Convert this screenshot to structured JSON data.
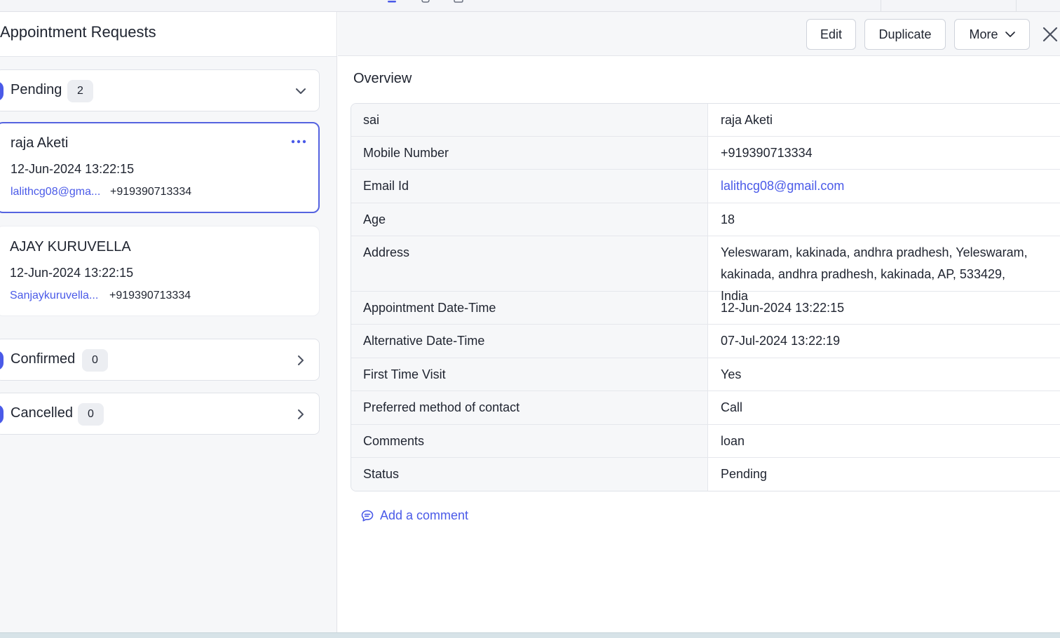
{
  "left_panel": {
    "title": "Appointment Requests",
    "groups": {
      "pending": {
        "label": "Pending",
        "count": "2"
      },
      "confirmed": {
        "label": "Confirmed",
        "count": "0"
      },
      "cancelled": {
        "label": "Cancelled",
        "count": "0"
      }
    },
    "cards": [
      {
        "name": "raja Aketi",
        "date": "12-Jun-2024 13:22:15",
        "email": "lalithcg08@gma...",
        "phone": "+919390713334"
      },
      {
        "name": "AJAY KURUVELLA",
        "date": "12-Jun-2024 13:22:15",
        "email": "Sanjaykuruvella...",
        "phone": "+919390713334"
      }
    ]
  },
  "toolbar": {
    "edit_label": "Edit",
    "duplicate_label": "Duplicate",
    "more_label": "More"
  },
  "detail": {
    "section_title": "Overview",
    "rows": [
      {
        "label": "sai",
        "value": "raja Aketi"
      },
      {
        "label": "Mobile Number",
        "value": "+919390713334"
      },
      {
        "label": "Email Id",
        "value": "lalithcg08@gmail.com"
      },
      {
        "label": "Age",
        "value": "18"
      },
      {
        "label": "Address",
        "value": "Yeleswaram, kakinada, andhra pradhesh, Yeleswaram, kakinada, andhra pradhesh, kakinada, AP, 533429, India"
      },
      {
        "label": "Appointment Date-Time",
        "value": "12-Jun-2024 13:22:15"
      },
      {
        "label": "Alternative Date-Time",
        "value": "07-Jul-2024 13:22:19"
      },
      {
        "label": "First Time Visit",
        "value": "Yes"
      },
      {
        "label": "Preferred method of contact",
        "value": "Call"
      },
      {
        "label": "Comments",
        "value": "loan"
      },
      {
        "label": "Status",
        "value": "Pending"
      }
    ],
    "add_comment_label": "Add a comment"
  },
  "colors": {
    "accent": "#4a5ae8",
    "panel_bg": "#f6f7f9",
    "border": "#dfe2e8"
  },
  "icons": [
    "list-icon",
    "chevron-down-icon",
    "chevron-right-icon",
    "more-dots-icon",
    "close-icon",
    "comment-icon"
  ]
}
